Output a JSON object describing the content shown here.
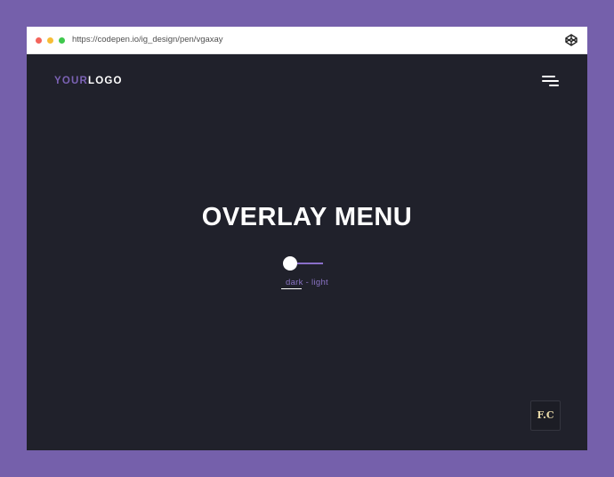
{
  "browser": {
    "url": "https://codepen.io/ig_design/pen/vgaxay",
    "icon": "codepen-icon"
  },
  "header": {
    "logo_accent": "YOUR",
    "logo_rest": "LOGO",
    "menu_icon": "hamburger-menu-icon"
  },
  "main": {
    "title": "OVERLAY MENU",
    "toggle_label": "dark - light",
    "toggle_state": "dark"
  },
  "footer": {
    "badge_text": "F.C"
  },
  "colors": {
    "page_background": "#7560ab",
    "dark_background": "#20212b",
    "accent": "#7b62b4",
    "badge_text": "#e8d9a8"
  }
}
